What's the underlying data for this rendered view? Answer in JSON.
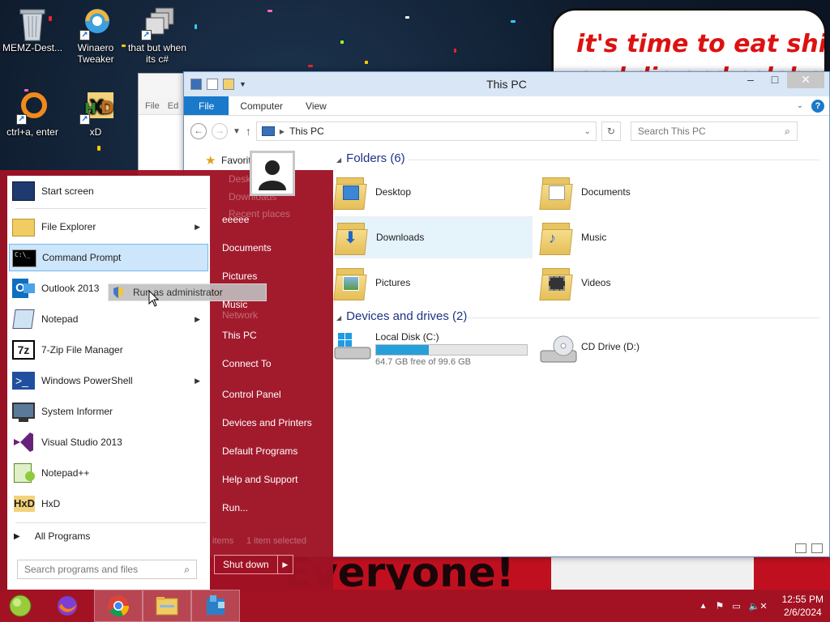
{
  "desktop": {
    "icons": [
      {
        "label": "MEMZ-Dest..."
      },
      {
        "label": "Winaero Tweaker"
      },
      {
        "label": "that but when its c#"
      },
      {
        "label": "ctrl+a, enter"
      },
      {
        "label": "xD"
      }
    ],
    "meme_top_line1": "it's time to eat shit",
    "meme_top_line2": "and die and celebrate",
    "meme_bottom": "Everyone!",
    "bg_window_menu": [
      "File",
      "Ed"
    ]
  },
  "explorer": {
    "title": "This PC",
    "ribbon_tabs": [
      "File",
      "Computer",
      "View"
    ],
    "address": "This PC",
    "search_placeholder": "Search This PC",
    "nav_favorites": "Favorites",
    "folders_header": "Folders (6)",
    "folders": [
      {
        "name": "Desktop"
      },
      {
        "name": "Documents"
      },
      {
        "name": "Downloads"
      },
      {
        "name": "Music"
      },
      {
        "name": "Pictures"
      },
      {
        "name": "Videos"
      }
    ],
    "drives_header": "Devices and drives (2)",
    "drives": [
      {
        "name": "Local Disk (C:)",
        "free": "64.7 GB free of 99.6 GB",
        "used_fraction": 0.35
      },
      {
        "name": "CD Drive (D:)"
      }
    ],
    "status_ghost": [
      "items",
      "1 item selected"
    ]
  },
  "start_menu": {
    "programs": [
      {
        "label": "Start screen",
        "icon": "start-screen-icon"
      },
      {
        "label": "File Explorer",
        "icon": "file-explorer-icon",
        "arrow": true
      },
      {
        "label": "Command Prompt",
        "icon": "command-prompt-icon",
        "selected": true
      },
      {
        "label": "Outlook 2013",
        "icon": "outlook-icon"
      },
      {
        "label": "Notepad",
        "icon": "notepad-icon",
        "arrow": true
      },
      {
        "label": "7-Zip File Manager",
        "icon": "seven-zip-icon"
      },
      {
        "label": "Windows PowerShell",
        "icon": "powershell-icon",
        "arrow": true
      },
      {
        "label": "System Informer",
        "icon": "system-informer-icon"
      },
      {
        "label": "Visual Studio 2013",
        "icon": "visual-studio-icon"
      },
      {
        "label": "Notepad++",
        "icon": "notepad-plus-plus-icon"
      },
      {
        "label": "HxD",
        "icon": "hxd-icon"
      }
    ],
    "all_programs": "All Programs",
    "search_placeholder": "Search programs and files",
    "right_items": [
      "eeeee",
      "Documents",
      "Pictures",
      "Music",
      "This PC",
      "Connect To",
      "Control Panel",
      "Devices and Printers",
      "Default Programs",
      "Help and Support",
      "Run..."
    ],
    "ghost_items": [
      "Desk",
      "Downloads",
      "Recent places",
      "Network"
    ],
    "shutdown": "Shut down",
    "tooltip": "Run as administrator"
  },
  "taskbar": {
    "time": "12:55 PM",
    "date": "2/6/2024"
  },
  "colors": {
    "start_red": "#9e1224",
    "taskbar_red": "#a31222",
    "accent_blue": "#1979ca",
    "drive_bar": "#26a0da"
  }
}
